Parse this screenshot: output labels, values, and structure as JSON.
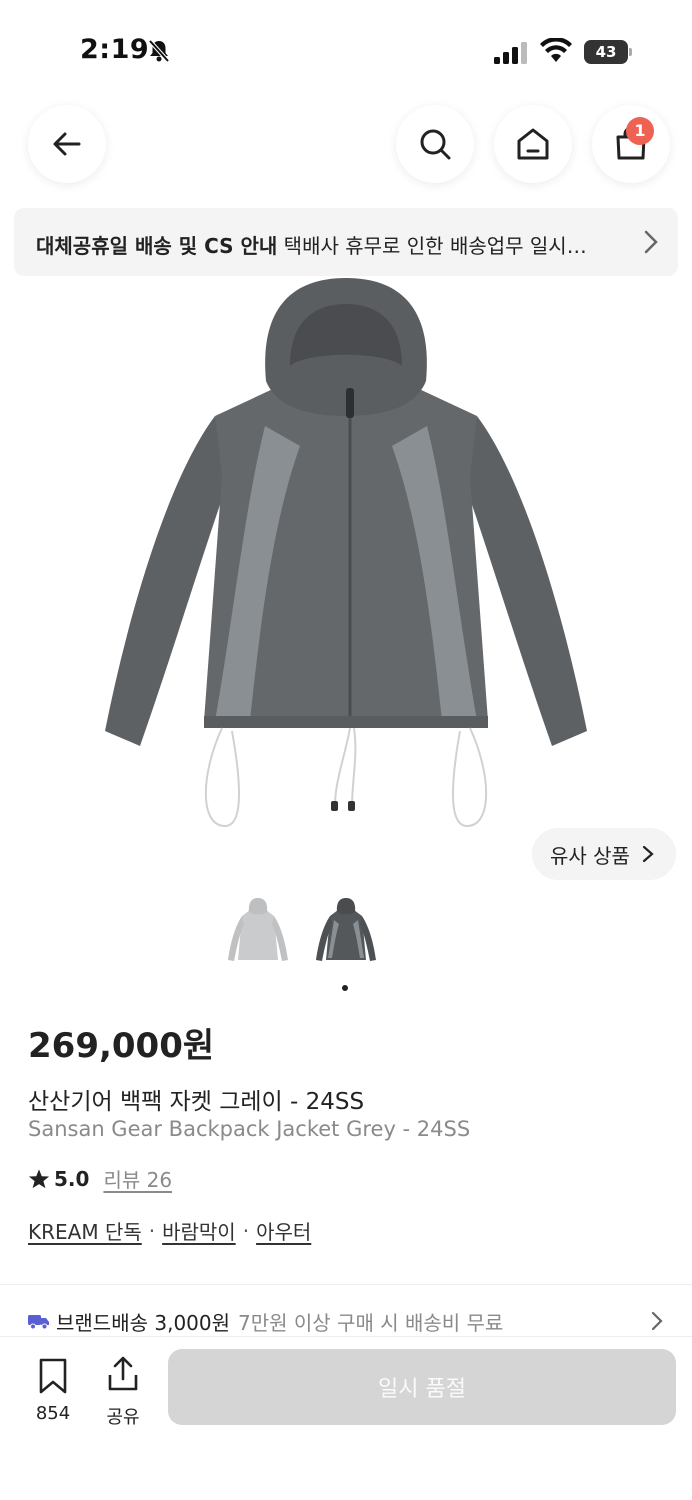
{
  "status_bar": {
    "time": "2:19",
    "battery": "43"
  },
  "nav": {
    "cart_count": "1"
  },
  "notice": {
    "title": "대체공휴일 배송 및 CS 안내",
    "body": " 택배사 휴무로 인한 배송업무 일시…"
  },
  "similar": {
    "label": "유사 상품"
  },
  "product": {
    "price": "269,000원",
    "name_ko": "산산기어 백팩 자켓 그레이 - 24SS",
    "name_en": "Sansan Gear Backpack Jacket Grey - 24SS",
    "rating": "5.0",
    "review_label": "리뷰 26",
    "tags": [
      "KREAM 단독",
      "바람막이",
      "아우터"
    ],
    "color": "#5e6164"
  },
  "delivery": {
    "label": "브랜드배송 3,000원",
    "note": "7만원 이상 구매 시 배송비 무료"
  },
  "bottom": {
    "bookmark_count": "854",
    "share_label": "공유",
    "buy_label": "일시 품절"
  },
  "colors": {
    "accent_badge": "#ef6253",
    "disabled_button": "#d5d5d5",
    "delivery_truck": "#5b5fd6"
  }
}
